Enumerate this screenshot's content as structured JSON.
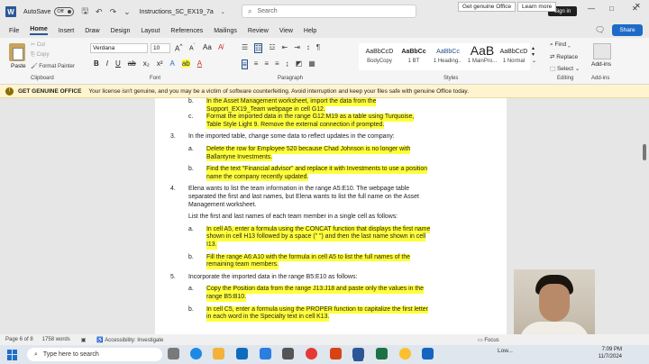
{
  "titlebar": {
    "autosave_label": "AutoSave",
    "autosave_state": "Off",
    "filename": "Instructions_SC_EX19_7a",
    "search_placeholder": "Search",
    "signin_label": "Sign in",
    "minimize": "—",
    "maximize": "□",
    "close": "✕"
  },
  "menu": {
    "tabs": [
      "File",
      "Home",
      "Insert",
      "Draw",
      "Design",
      "Layout",
      "References",
      "Mailings",
      "Review",
      "View",
      "Help"
    ],
    "share_label": "Share"
  },
  "ribbon": {
    "clipboard": {
      "paste": "Paste",
      "cut": "Cut",
      "copy": "Copy",
      "format_painter": "Format Painter",
      "label": "Clipboard"
    },
    "font": {
      "name": "Verdana",
      "size": "10",
      "label": "Font"
    },
    "paragraph": {
      "label": "Paragraph"
    },
    "styles": {
      "label": "Styles",
      "items": [
        {
          "preview": "AaBbCcD",
          "name": "BodyCopy"
        },
        {
          "preview": "AaBbCc",
          "name": "1 BT"
        },
        {
          "preview": "AaBbCc",
          "name": "1 Heading..."
        },
        {
          "preview": "AaB",
          "name": "1 MainPro..."
        },
        {
          "preview": "AaBbCcD",
          "name": "1 Normal"
        }
      ]
    },
    "editing": {
      "find": "Find",
      "replace": "Replace",
      "select": "Select",
      "label": "Editing"
    },
    "addins": {
      "name": "Add-ins",
      "label": "Add-ins"
    }
  },
  "warning": {
    "title": "GET GENUINE OFFICE",
    "message": "Your license isn't genuine, and you may be a victim of software counterfeiting. Avoid interruption and keep your files safe with genuine Office today.",
    "primary_button": "Get genuine Office",
    "secondary_button": "Learn more"
  },
  "document": {
    "lines": [
      {
        "num": "b.",
        "text": "In the Asset Management worksheet, import the data from the",
        "hl": true,
        "indent": 2
      },
      {
        "num": "",
        "text": "Support_EX19_Team webpage in cell G12.",
        "hl": true,
        "indent": 2
      },
      {
        "num": "c.",
        "text": "Format the imported data in the range G12:M19 as a table using Turquoise,",
        "hl": true,
        "indent": 2
      },
      {
        "num": "",
        "text": "Table Style Light 9. Remove the external connection if prompted.",
        "hl": true,
        "indent": 2
      },
      {
        "num": "3.",
        "text": "In the imported table, change some data to reflect updates in the company:",
        "hl": false,
        "indent": 1
      },
      {
        "num": "a.",
        "text": "Delete the row for Employee 520 because Chad Johnson is no longer with",
        "hl": true,
        "indent": 2
      },
      {
        "num": "",
        "text": "Ballantyne Investments.",
        "hl": true,
        "indent": 2
      },
      {
        "num": "b.",
        "text": "Find the text \"Financial advisor\" and replace it with Investments to use a position",
        "hl": true,
        "indent": 2
      },
      {
        "num": "",
        "text": "name the company recently updated.",
        "hl": true,
        "indent": 2
      },
      {
        "num": "4.",
        "text": "Elena wants to list the team information in the range A5:E10. The webpage table",
        "hl": false,
        "indent": 1
      },
      {
        "num": "",
        "text": "separated the first and last names, but Elena wants to list the full name on the Asset",
        "hl": false,
        "indent": 1
      },
      {
        "num": "",
        "text": "Management worksheet.",
        "hl": false,
        "indent": 1
      },
      {
        "num": "",
        "text": "List the first and last names of each team member in a single cell as follows:",
        "hl": false,
        "indent": 1
      },
      {
        "num": "a.",
        "text": "In cell A5, enter a formula using the CONCAT function that displays the first name",
        "hl": true,
        "indent": 2
      },
      {
        "num": "",
        "text": "shown in cell H13 followed by a space (\" \") and then the last name shown in cell",
        "hl": true,
        "indent": 2
      },
      {
        "num": "",
        "text": "I13.",
        "hl": true,
        "indent": 2
      },
      {
        "num": "b.",
        "text": "Fill the range A6:A10 with the formula in cell A5 to list the full names of the",
        "hl": true,
        "indent": 2
      },
      {
        "num": "",
        "text": "remaining team members.",
        "hl": true,
        "indent": 2
      },
      {
        "num": "5.",
        "text": "Incorporate the imported data in the range B5:E10 as follows:",
        "hl": false,
        "indent": 1
      },
      {
        "num": "a.",
        "text": "Copy the Position data from the range J13:J18 and paste only the values in the",
        "hl": true,
        "indent": 2
      },
      {
        "num": "",
        "text": "range B5:B10.",
        "hl": true,
        "indent": 2
      },
      {
        "num": "b.",
        "text": "In cell C5, enter a formula using the PROPER function to capitalize the first letter",
        "hl": true,
        "indent": 2
      },
      {
        "num": "",
        "text": "in each word in the Specialty text in cell K13.",
        "hl": true,
        "indent": 2
      }
    ]
  },
  "statusbar": {
    "page": "Page 6 of 8",
    "words": "1758 words",
    "accessibility": "Accessibility: Investigate",
    "focus": "Focus"
  },
  "taskbar": {
    "search_placeholder": "Type here to search",
    "weather": "Low...",
    "time": "7:09 PM",
    "date": "11/7/2024"
  },
  "colors": {
    "highlight": "#ffff3b",
    "accent": "#2b5797",
    "share": "#1f6ac9",
    "warning_bg": "#fff4ce"
  }
}
